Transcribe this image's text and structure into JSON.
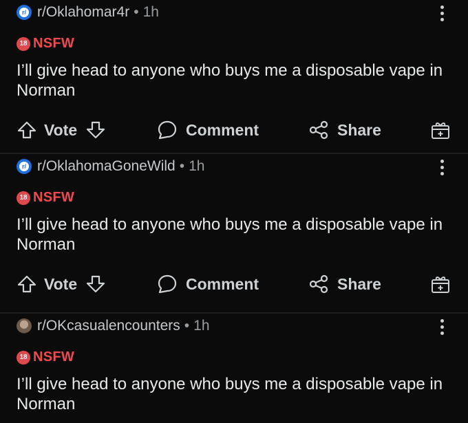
{
  "posts": [
    {
      "subreddit": "r/Oklahomar4r",
      "separator": "•",
      "time": "1h",
      "nsfw_label": "NSFW",
      "nsfw_badge": "18",
      "title": "I’ll give head to anyone who buys me a disposable vape in Norman",
      "actions": {
        "vote": "Vote",
        "comment": "Comment",
        "share": "Share"
      }
    },
    {
      "subreddit": "r/OklahomaGoneWild",
      "separator": "•",
      "time": "1h",
      "nsfw_label": "NSFW",
      "nsfw_badge": "18",
      "title": "I’ll give head to anyone who buys me a disposable vape in Norman",
      "actions": {
        "vote": "Vote",
        "comment": "Comment",
        "share": "Share"
      }
    },
    {
      "subreddit": "r/OKcasualencounters",
      "separator": "•",
      "time": "1h",
      "nsfw_label": "NSFW",
      "nsfw_badge": "18",
      "title": "I’ll give head to anyone who buys me a disposable vape in Norman"
    }
  ],
  "icons": {
    "subreddit_default": "r/",
    "upvote": "arrow-up-icon",
    "downvote": "arrow-down-icon",
    "comment": "speech-bubble-icon",
    "share": "share-icon",
    "award": "gift-icon",
    "more": "vertical-ellipsis-icon"
  },
  "colors": {
    "background": "#0b0b0b",
    "nsfw": "#ee4a4f",
    "subreddit_icon": "#1f6fe0",
    "text": "#e7e9ea"
  }
}
